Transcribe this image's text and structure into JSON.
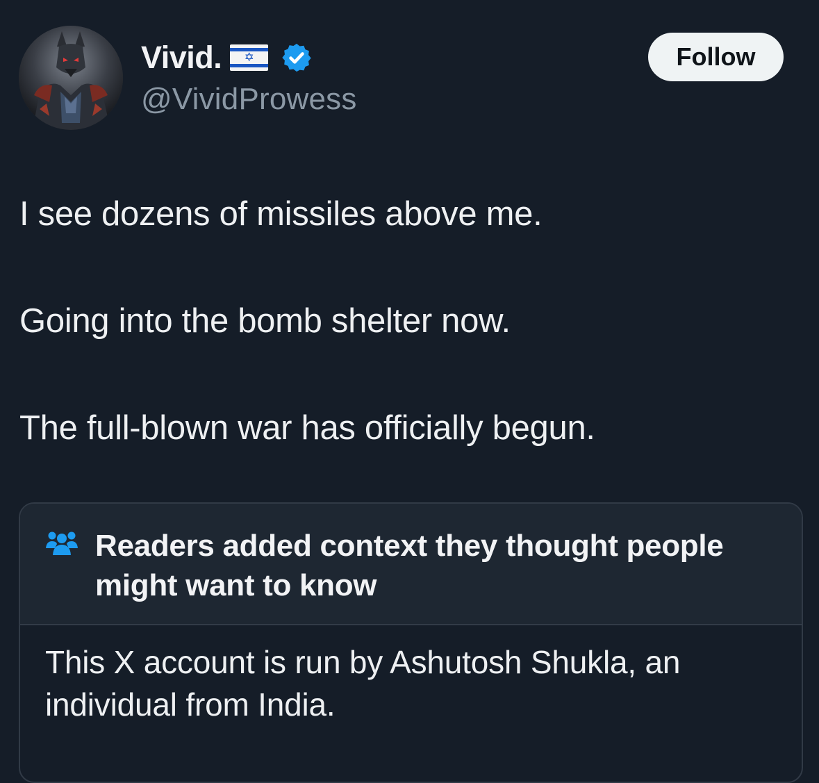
{
  "author": {
    "display_name": "Vivid.",
    "flag": "israel-flag",
    "handle": "@VividProwess",
    "verified": true
  },
  "follow_label": "Follow",
  "tweet": {
    "lines": [
      "I see dozens of missiles above me.",
      "Going into the bomb shelter now.",
      "The full-blown war has officially begun."
    ]
  },
  "community_note": {
    "title": "Readers added context they thought people might want to know",
    "text": "This X account is run by Ashutosh Shukla, an individual from India."
  },
  "colors": {
    "background": "#151d28",
    "verified_blue": "#1d9bf0",
    "note_header_bg": "#1e2732",
    "muted_text": "#8b98a5"
  }
}
